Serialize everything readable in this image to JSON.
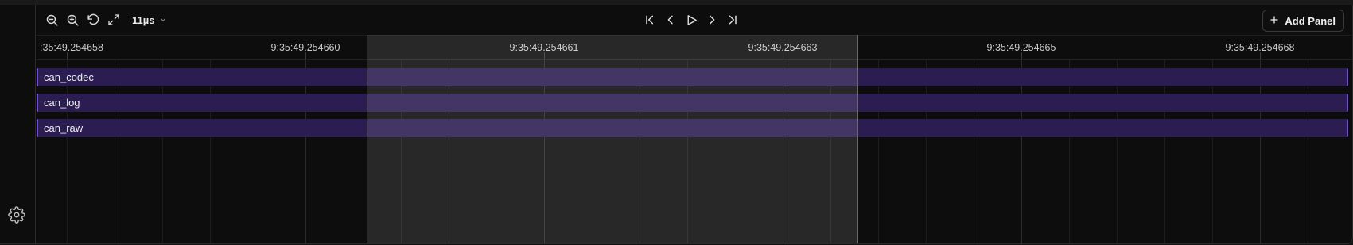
{
  "toolbar": {
    "zoom_level": "11µs",
    "add_panel_label": "Add Panel",
    "icons": [
      "zoom-out-icon",
      "zoom-in-icon",
      "undo-icon",
      "fit-icon",
      "chevron-down-icon",
      "skip-start-icon",
      "step-back-icon",
      "play-icon",
      "step-forward-icon",
      "skip-end-icon",
      "plus-icon"
    ]
  },
  "ruler": {
    "ticks": [
      ":35:49.254658",
      "9:35:49.254660",
      "9:35:49.254661",
      "9:35:49.254663",
      "9:35:49.254665",
      "9:35:49.254668"
    ]
  },
  "tracks": [
    {
      "label": "can_codec"
    },
    {
      "label": "can_log"
    },
    {
      "label": "can_raw"
    }
  ],
  "colors": {
    "track_fill": "#2b1d52",
    "track_edge": "#6d4cd6",
    "background": "#0d0d0d"
  },
  "sidebar": {
    "settings_icon": "gear-icon"
  }
}
